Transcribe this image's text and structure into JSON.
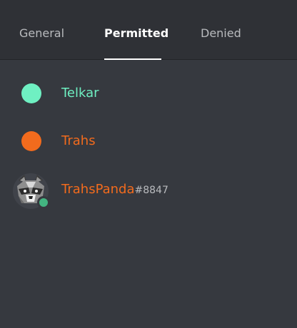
{
  "tabs": {
    "general": "General",
    "permitted": "Permitted",
    "denied": "Denied",
    "active": "Permitted"
  },
  "colors": {
    "background": "#36393f",
    "tabbar": "#2f3136",
    "active_tab": "#ffffff",
    "inactive_tab": "#b9bbbe",
    "online_status": "#43b581"
  },
  "permitted": [
    {
      "type": "role",
      "name": "Telkar",
      "color": "#6ff0c2"
    },
    {
      "type": "role",
      "name": "Trahs",
      "color": "#f26b1d"
    },
    {
      "type": "member",
      "name": "TrahsPanda",
      "discriminator": "#8847",
      "color": "#f26b1d",
      "status": "online",
      "avatar": "raccoon-avatar"
    }
  ]
}
